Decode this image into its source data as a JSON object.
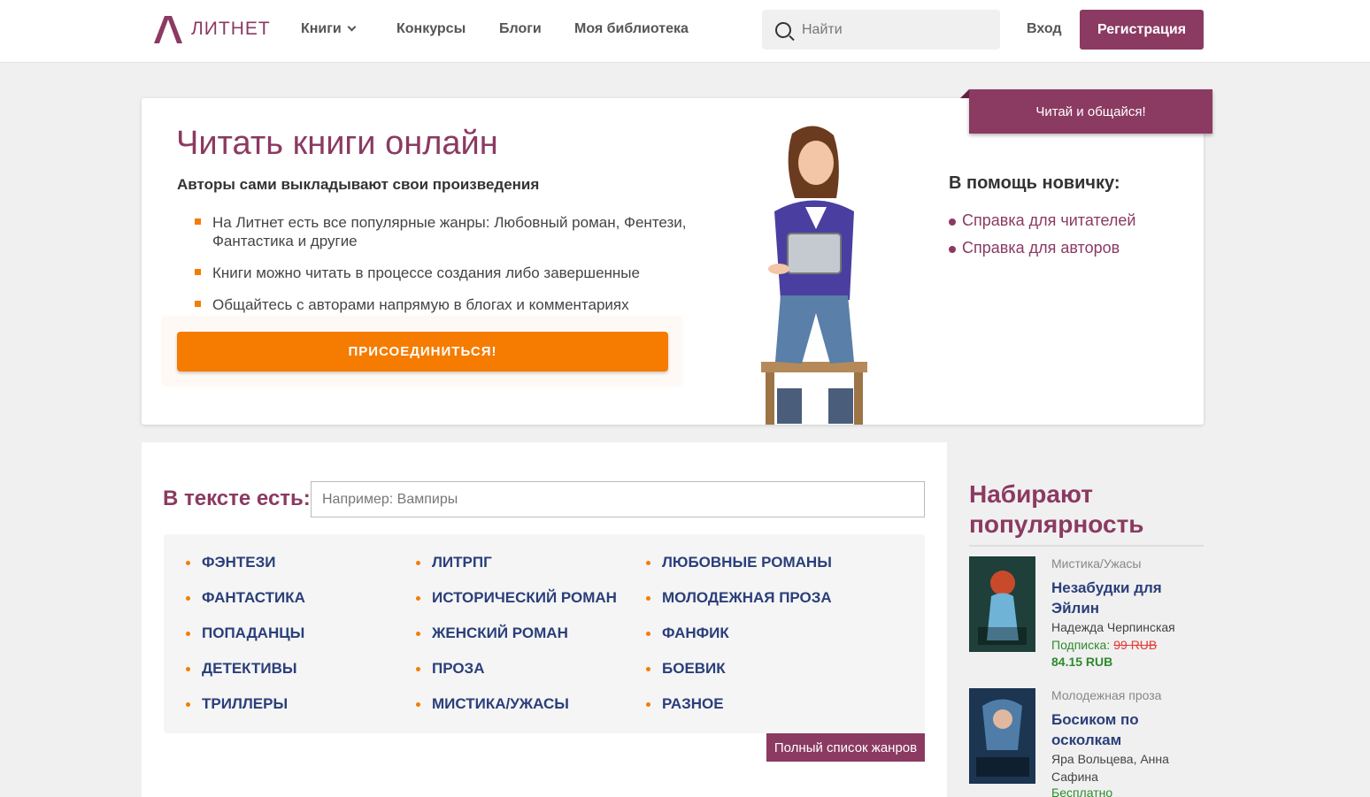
{
  "header": {
    "logo_text": "ЛИТНЕТ",
    "nav": [
      "Книги",
      "Конкурсы",
      "Блоги",
      "Моя библиотека"
    ],
    "search_placeholder": "Найти",
    "login": "Вход",
    "register": "Регистрация"
  },
  "hero": {
    "title": "Читать книги онлайн",
    "subtitle": "Авторы сами выкладывают свои произведения",
    "bullets": [
      "На Литнет есть все популярные жанры: Любовный роман, Фентези, Фантастика и другие",
      "Книги можно читать в процессе создания либо завершенные",
      "Общайтесь с авторами напрямую в блогах и комментариях"
    ],
    "join_button": "ПРИСОЕДИНИТЬСЯ!",
    "ribbon": "Читай и общайся!",
    "help_title": "В помощь новичку:",
    "help_links": [
      "Справка для читателей",
      "Справка для авторов"
    ]
  },
  "genres": {
    "label": "В тексте есть:",
    "search_placeholder": "Например: Вампиры",
    "columns": [
      [
        "Фэнтези",
        "Фантастика",
        "Попаданцы",
        "Детективы",
        "Триллеры"
      ],
      [
        "ЛитРПГ",
        "Исторический роман",
        "Женский роман",
        "Проза",
        "Мистика/Ужасы"
      ],
      [
        "Любовные романы",
        "Молодежная проза",
        "Фанфик",
        "Боевик",
        "Разное"
      ]
    ],
    "full_list": "Полный список жанров"
  },
  "sidebar": {
    "title": "Набирают популярность",
    "books": [
      {
        "genre": "Мистика/Ужасы",
        "title": "Незабудки для Эйлин",
        "author": "Надежда Черпинская",
        "price_label": "Подписка:",
        "old_price": "99 RUB",
        "new_price": "84.15 RUB"
      },
      {
        "genre": "Молодежная проза",
        "title": "Босиком по осколкам",
        "author": "Яра Вольцева, Анна Сафина",
        "price_label": "Бесплатно"
      }
    ]
  },
  "colors": {
    "brand": "#8b3a62",
    "accent": "#f57c00",
    "link": "#2a3f7a"
  }
}
